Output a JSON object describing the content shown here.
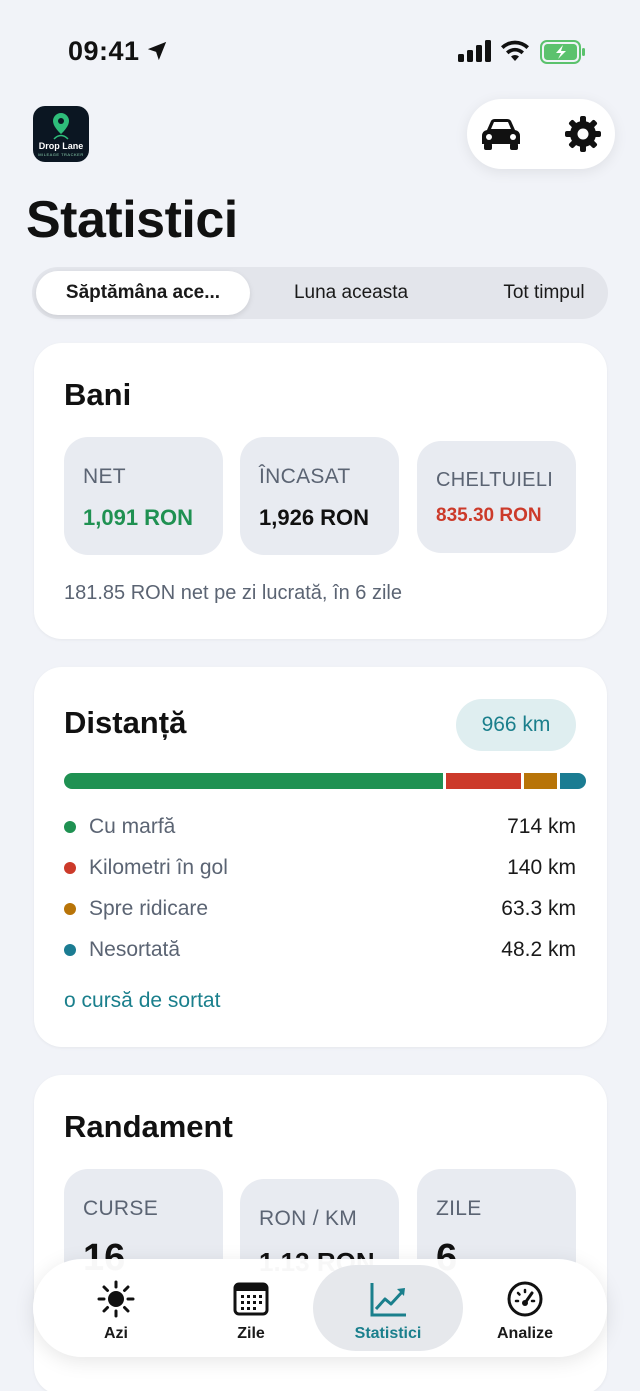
{
  "status": {
    "time": "09:41"
  },
  "logo": {
    "name": "Drop Lane",
    "sub": "MILEAGE TRACKER"
  },
  "page_title": "Statistici",
  "segments": [
    "Săptămâna ace...",
    "Luna aceasta",
    "Tot timpul"
  ],
  "money": {
    "title": "Bani",
    "net_label": "NET",
    "net_value": "1,091 RON",
    "income_label": "ÎNCASAT",
    "income_value": "1,926 RON",
    "expenses_label": "CHELTUIELI",
    "expenses_value": "835.30 RON",
    "note": "181.85 RON net pe zi lucrată, în 6 zile"
  },
  "distance": {
    "title": "Distanță",
    "total": "966 km",
    "rows": [
      {
        "label": "Cu marfă",
        "value": "714 km",
        "km": 714,
        "color": "#1f9152"
      },
      {
        "label": "Kilometri în gol",
        "value": "140 km",
        "km": 140,
        "color": "#cc3a2a"
      },
      {
        "label": "Spre ridicare",
        "value": "63.3 km",
        "km": 63.3,
        "color": "#b87408"
      },
      {
        "label": "Nesortată",
        "value": "48.2 km",
        "km": 48.2,
        "color": "#1b7c92"
      }
    ],
    "sort_link": "o cursă de sortat"
  },
  "performance": {
    "title": "Randament",
    "trips_label": "CURSE",
    "trips_value": "16",
    "per_km_label": "RON / KM",
    "per_km_value": "1.13 RON",
    "days_label": "ZILE",
    "days_value": "6"
  },
  "tabs": [
    {
      "label": "Azi",
      "icon": "sun-icon"
    },
    {
      "label": "Zile",
      "icon": "calendar-icon"
    },
    {
      "label": "Statistici",
      "icon": "chart-icon"
    },
    {
      "label": "Analize",
      "icon": "gauge-icon"
    }
  ],
  "colors": {
    "accent": "#1a7f8c",
    "positive": "#1f9152",
    "negative": "#cc3a2a"
  }
}
